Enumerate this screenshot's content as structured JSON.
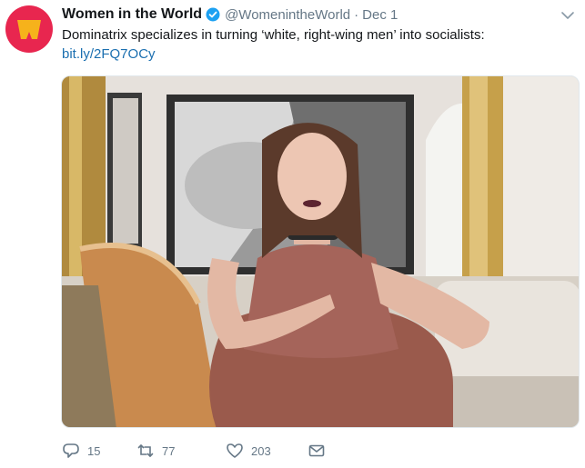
{
  "tweet": {
    "author": {
      "display_name": "Women in the World",
      "handle": "@WomenintheWorld",
      "verified": true,
      "avatar_color": "#e8264f"
    },
    "separator": "·",
    "date": "Dec 1",
    "text": "Dominatrix specializes in turning ‘white, right-wing men’ into socialists:",
    "link": "bit.ly/2FQ7OCy",
    "media": {
      "type": "photo"
    },
    "actions": {
      "reply_count": "15",
      "retweet_count": "77",
      "like_count": "203"
    }
  },
  "icons": {
    "verified": "verified-badge-icon",
    "menu": "chevron-down-icon",
    "reply": "reply-icon",
    "retweet": "retweet-icon",
    "like": "heart-icon",
    "dm": "envelope-icon"
  },
  "colors": {
    "text": "#14171a",
    "secondary": "#657786",
    "link": "#1b6fb0",
    "verified": "#1da1f2"
  }
}
